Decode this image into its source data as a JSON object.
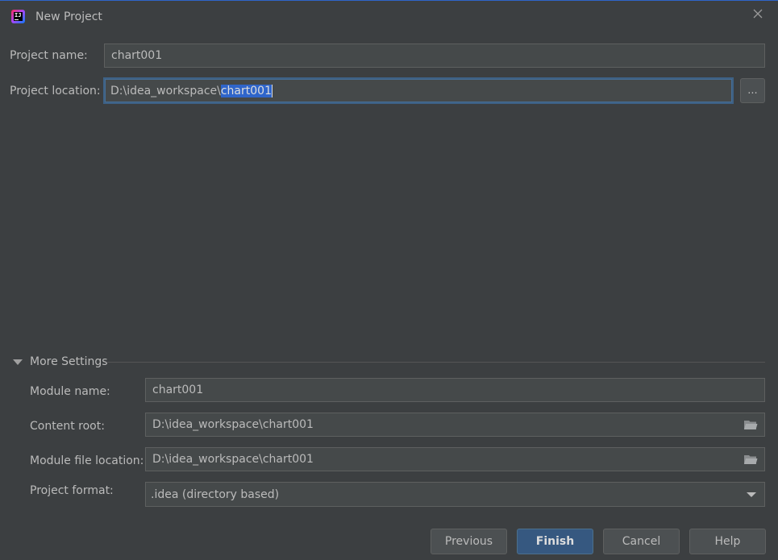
{
  "window": {
    "title": "New Project",
    "app_icon": "intellij-idea-icon",
    "close_icon": "close-icon"
  },
  "project": {
    "name_label": "Project name:",
    "name_value": "chart001",
    "location_label": "Project location:",
    "location_prefix": "D:\\idea_workspace\\",
    "location_selected": "chart001",
    "browse_label": "..."
  },
  "more_settings": {
    "label": "More Settings",
    "expanded": true,
    "module_name_label": "Module name:",
    "module_name_value": "chart001",
    "content_root_label": "Content root:",
    "content_root_value": "D:\\idea_workspace\\chart001",
    "module_file_label": "Module file location:",
    "module_file_value": "D:\\idea_workspace\\chart001",
    "project_format_label": "Project format:",
    "project_format_value": ".idea (directory based)"
  },
  "buttons": {
    "previous": "Previous",
    "finish": "Finish",
    "cancel": "Cancel",
    "help": "Help"
  },
  "colors": {
    "background": "#3c3f41",
    "field": "#45494a",
    "selection": "#2f65ca",
    "default_button": "#365880",
    "focus_border": "#3d6185"
  }
}
